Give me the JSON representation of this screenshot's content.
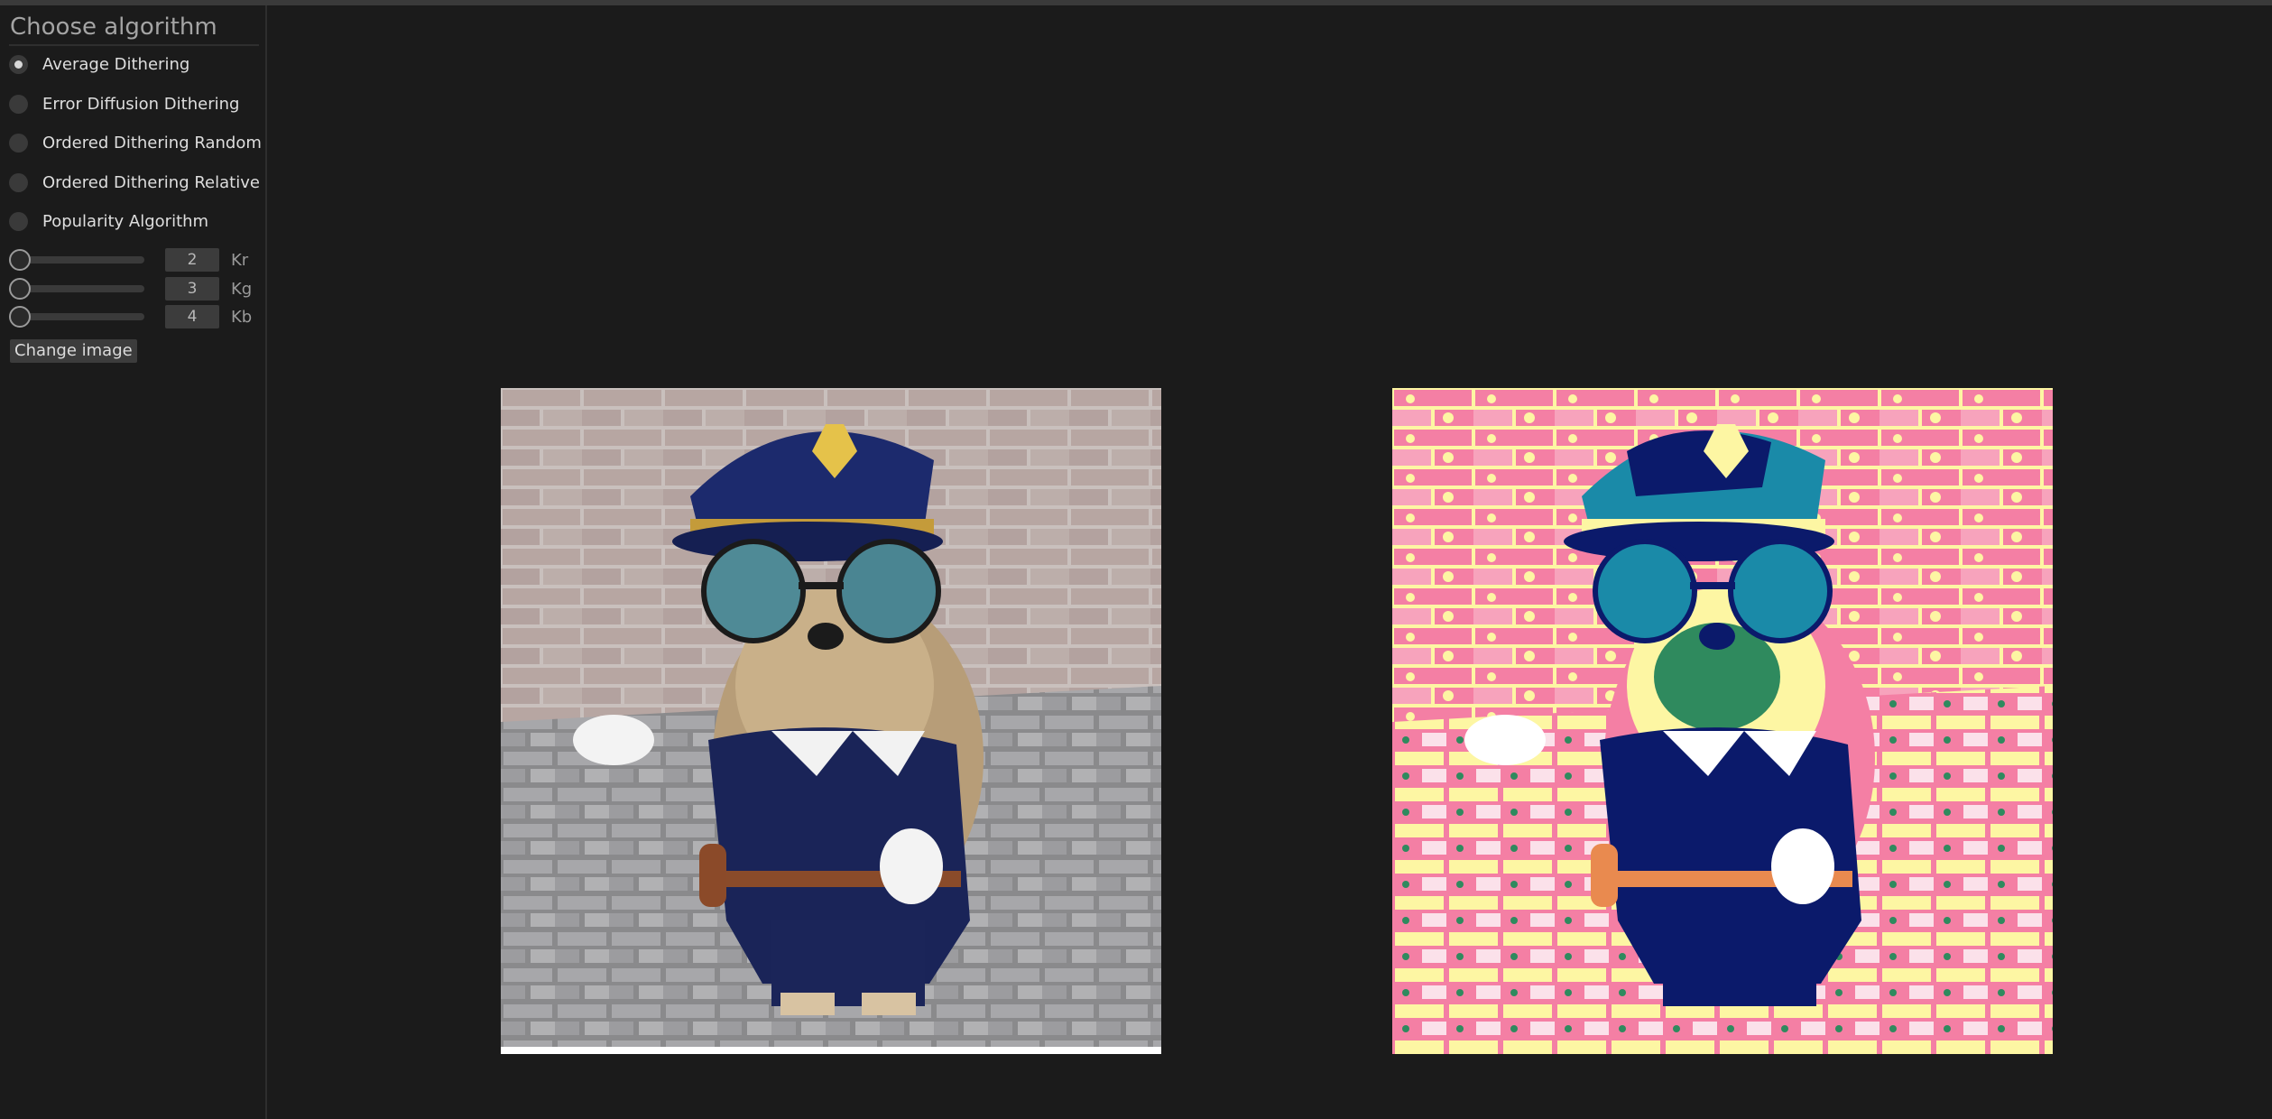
{
  "sidebar": {
    "title": "Choose algorithm",
    "algorithms": [
      {
        "label": "Average Dithering",
        "checked": true
      },
      {
        "label": "Error Diffusion Dithering",
        "checked": false
      },
      {
        "label": "Ordered Dithering Random",
        "checked": false
      },
      {
        "label": "Ordered Dithering Relative",
        "checked": false
      },
      {
        "label": "Popularity Algorithm",
        "checked": false
      }
    ],
    "sliders": [
      {
        "value": "2",
        "label": "Kr"
      },
      {
        "value": "3",
        "label": "Kg"
      },
      {
        "value": "4",
        "label": "Kb"
      }
    ],
    "change_image_label": "Change image"
  },
  "images": {
    "original": {
      "description_icon": "dog-police-photo"
    },
    "dithered": {
      "description_icon": "dog-police-dithered-photo"
    }
  },
  "colors": {
    "background": "#1b1b1b",
    "panel_text": "#a4a4a4",
    "dither_pink": "#f47fa4",
    "dither_yellow": "#fdf6a3",
    "dither_navy": "#0b1a6b",
    "dither_teal": "#1a8aa8"
  }
}
